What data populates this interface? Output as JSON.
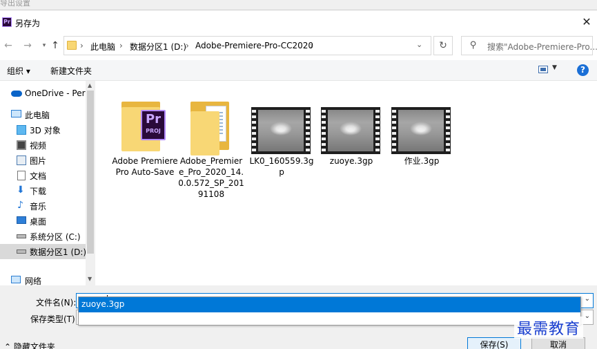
{
  "background_window": {
    "title": "导出设置"
  },
  "dialog": {
    "title": "另存为",
    "app_icon_text": "Pr",
    "close_glyph": "✕"
  },
  "address_bar": {
    "crumbs": [
      "此电脑",
      "数据分区1 (D:)",
      "Adobe-Premiere-Pro-CC2020"
    ],
    "separator": "›"
  },
  "search": {
    "placeholder": "搜索\"Adobe-Premiere-Pro..."
  },
  "toolbar": {
    "organize_label": "组织 ▾",
    "new_folder_label": "新建文件夹",
    "help_glyph": "?"
  },
  "nav_pane": {
    "items": [
      {
        "label": "OneDrive - Personal",
        "icon": "onedrive-icon"
      },
      {
        "label": "此电脑",
        "icon": "computer-icon"
      },
      {
        "label": "3D 对象",
        "icon": "3d-objects-icon"
      },
      {
        "label": "视频",
        "icon": "video-folder-icon"
      },
      {
        "label": "图片",
        "icon": "pictures-folder-icon"
      },
      {
        "label": "文档",
        "icon": "documents-folder-icon"
      },
      {
        "label": "下载",
        "icon": "download-icon"
      },
      {
        "label": "音乐",
        "icon": "music-icon"
      },
      {
        "label": "桌面",
        "icon": "desktop-icon"
      },
      {
        "label": "系统分区 (C:)",
        "icon": "drive-icon"
      },
      {
        "label": "数据分区1 (D:)",
        "icon": "drive-icon",
        "selected": true
      },
      {
        "label": "网络",
        "icon": "network-icon"
      }
    ]
  },
  "files": [
    {
      "name": "Adobe Premiere Pro Auto-Save",
      "type": "folder-premiere"
    },
    {
      "name": "Adobe_Premiere_Pro_2020_14.0.0.572_SP_20191108",
      "type": "folder-docs"
    },
    {
      "name": "LK0_160559.3gp",
      "type": "video"
    },
    {
      "name": "zuoye.3gp",
      "type": "video"
    },
    {
      "name": "作业.3gp",
      "type": "video"
    }
  ],
  "save_form": {
    "filename_label": "文件名(N):",
    "filename_value": "zuoye",
    "filetype_label": "保存类型(T):",
    "filetype_value": "",
    "suggestion": "zuoye.3gp"
  },
  "footer": {
    "hide_folders_label": "隐藏文件夹",
    "save_label": "保存(S)",
    "cancel_label": "取消"
  },
  "watermark": "最需教育",
  "colors": {
    "accent": "#0078d7",
    "premiere_purple": "#2a0a3a",
    "folder_yellow": "#f8d775",
    "watermark_blue": "#1a3fd0"
  }
}
